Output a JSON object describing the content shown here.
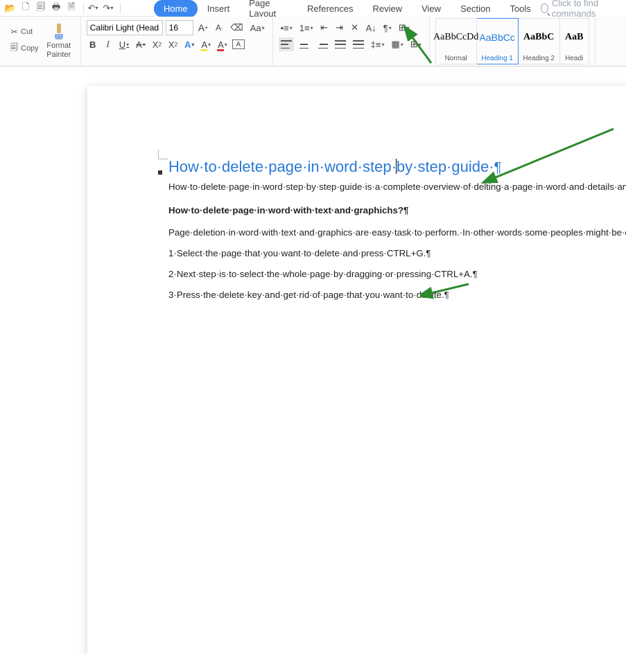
{
  "titlebar": {
    "icons": [
      "open",
      "new",
      "template",
      "print",
      "print-preview",
      "undo",
      "redo"
    ]
  },
  "menu": {
    "items": [
      "Home",
      "Insert",
      "Page Layout",
      "References",
      "Review",
      "View",
      "Section",
      "Tools"
    ],
    "active": "Home",
    "search_placeholder": "Click to find commands"
  },
  "ribbon": {
    "cut": "Cut",
    "copy": "Copy",
    "format_painter": "Format\nPainter",
    "font_name": "Calibri Light (Headi",
    "font_size": "16"
  },
  "styles": [
    {
      "sample": "AaBbCcDd",
      "label": "Normal",
      "variant": "normal"
    },
    {
      "sample": "AaBbCc",
      "label": "Heading 1",
      "variant": "heading",
      "selected": true
    },
    {
      "sample": "AaBbC",
      "label": "Heading 2",
      "variant": "bold"
    },
    {
      "sample": "AaB",
      "label": "Headi",
      "variant": "bold",
      "half": true
    }
  ],
  "doc": {
    "heading_before": "How·to·delete·page·in·word·step·",
    "heading_after": "by·step·guide·",
    "p1": "How·to·delete·page·in·word·step·by·step·guide·is·a·complete·overview·of·delting·a·page·in·word·and·details·analysis·of·different·ways·that·are·used.·Most·of·the·times·professionals·and·students·needs·to·complete·a·document·for·their·work·related·assignments·or·project·preprations.·In·this·situation·unnecessary·pages·are·impacts·on·the·image·of·the·documents·to·make·hi·professioanal·looking·or·worst·document.·In·this·guide·you'll·understand·How·to·delete·page·in·word·that·helps·you·checking·and·removing·the·extra·pages·in·word.¶",
    "p2": "How·to·delete·page·in·word·with·text·and·graphichs?¶",
    "p3": "Page·deletion·in·word·with·text·and·graphics·are·easy·task·to·perform.·In·other·words·some·peoples·might·be·confused·about·delting·a·completely·blank·and·full·page·is·same.¶",
    "p4": "1·Select·the·page·that·you·want·to·delete·and·press·CTRL+G.¶",
    "p5": "2·Next·step·is·to·select·the·whole·page·by·dragging·or·pressing·CTRL+A.¶",
    "p6": "3·Press·the·delete·key·and·get·rid·of·page·that·you·want·to·delete.¶"
  }
}
